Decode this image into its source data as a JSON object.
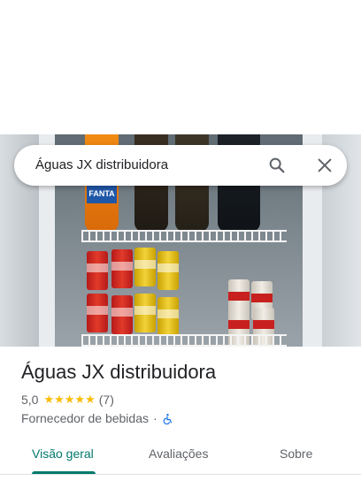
{
  "search": {
    "query": "Águas JX distribuidora"
  },
  "photo": {
    "label": "FANTA",
    "description_icon": "store-photo"
  },
  "place": {
    "name": "Águas JX distribuidora",
    "rating": "5,0",
    "stars": "★★★★★",
    "review_count": "(7)",
    "category": "Fornecedor de bebidas",
    "separator": "·"
  },
  "tabs": [
    {
      "label": "Visão geral",
      "active": true
    },
    {
      "label": "Avaliações",
      "active": false
    },
    {
      "label": "Sobre",
      "active": false
    }
  ],
  "colors": {
    "accent": "#00796b",
    "star": "#fbbc04",
    "wheelchair": "#1a73e8"
  }
}
